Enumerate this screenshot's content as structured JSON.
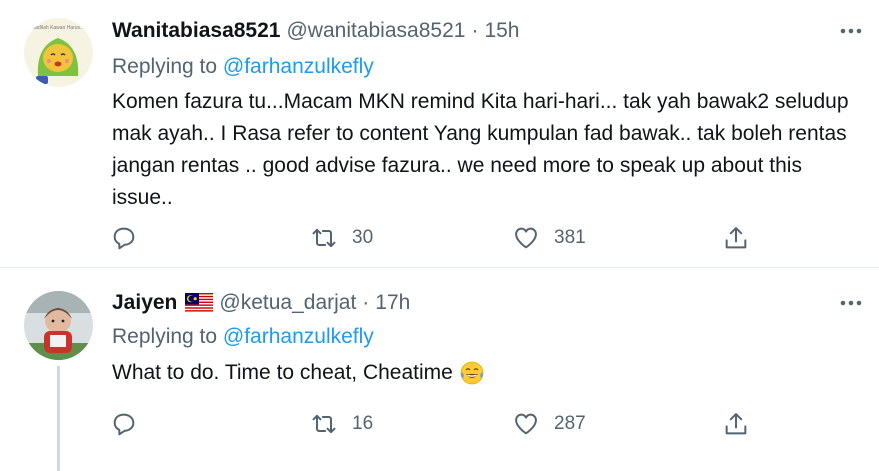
{
  "tweets": [
    {
      "display_name": "Wanitabiasa8521",
      "handle": "@wanitabiasa8521",
      "separator": "·",
      "time": "15h",
      "avatar_text": "Jadilah Kawan Harus...",
      "replying_prefix": "Replying to",
      "replying_to": "@farhanzulkefly",
      "body": "Komen fazura tu...Macam MKN remind Kita hari-hari... tak yah bawak2 seludup mak ayah.. I Rasa refer to content Yang kumpulan fad bawak.. tak boleh rentas jangan rentas .. good advise fazura.. we need more to speak up about this issue..",
      "actions": {
        "retweets": "30",
        "likes": "381"
      }
    },
    {
      "display_name": "Jaiyen",
      "flag_icon": "malaysia-flag-icon",
      "handle": "@ketua_darjat",
      "separator": "·",
      "time": "17h",
      "replying_prefix": "Replying to",
      "replying_to": "@farhanzulkefly",
      "body": "What to do. Time to cheat, Cheatime",
      "emoji_icon": "face-with-tears-of-joy-icon",
      "actions": {
        "retweets": "16",
        "likes": "287"
      }
    }
  ],
  "colors": {
    "accent": "#1d9bf0",
    "secondary_text": "#536471",
    "primary_text": "#0f1419",
    "divider": "#e6ecf0"
  }
}
